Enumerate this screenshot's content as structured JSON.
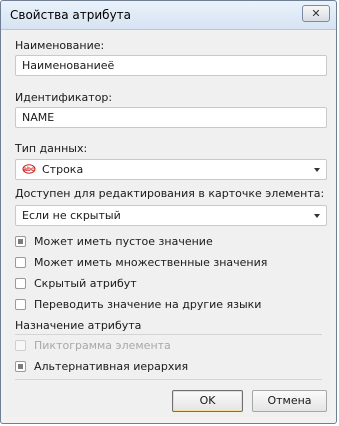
{
  "window": {
    "title": "Свойства атрибута",
    "close_glyph": "✕"
  },
  "name": {
    "label": "Наименование:",
    "value": "Наименованиеё"
  },
  "identifier": {
    "label": "Идентификатор:",
    "value": "NAME"
  },
  "data_type": {
    "label": "Тип данных:",
    "selected": "Строка",
    "icon": "abc-string-icon"
  },
  "editable": {
    "label": "Доступен для редактирования в карточке элемента:",
    "selected": "Если не скрытый"
  },
  "options": [
    {
      "label": "Может иметь пустое значение",
      "state": "indeterminate"
    },
    {
      "label": "Может иметь множественные значения",
      "state": "unchecked"
    },
    {
      "label": "Скрытый атрибут",
      "state": "unchecked"
    },
    {
      "label": "Переводить значение на другие языки",
      "state": "unchecked"
    }
  ],
  "purpose": {
    "label": "Назначение атрибута",
    "items": [
      {
        "label": "Пиктограмма элемента",
        "state": "disabled"
      },
      {
        "label": "Альтернативная иерархия",
        "state": "indeterminate"
      }
    ]
  },
  "buttons": {
    "ok": "OK",
    "cancel": "Отмена"
  },
  "colors": {
    "abc_icon_red": "#cc1f1f"
  }
}
